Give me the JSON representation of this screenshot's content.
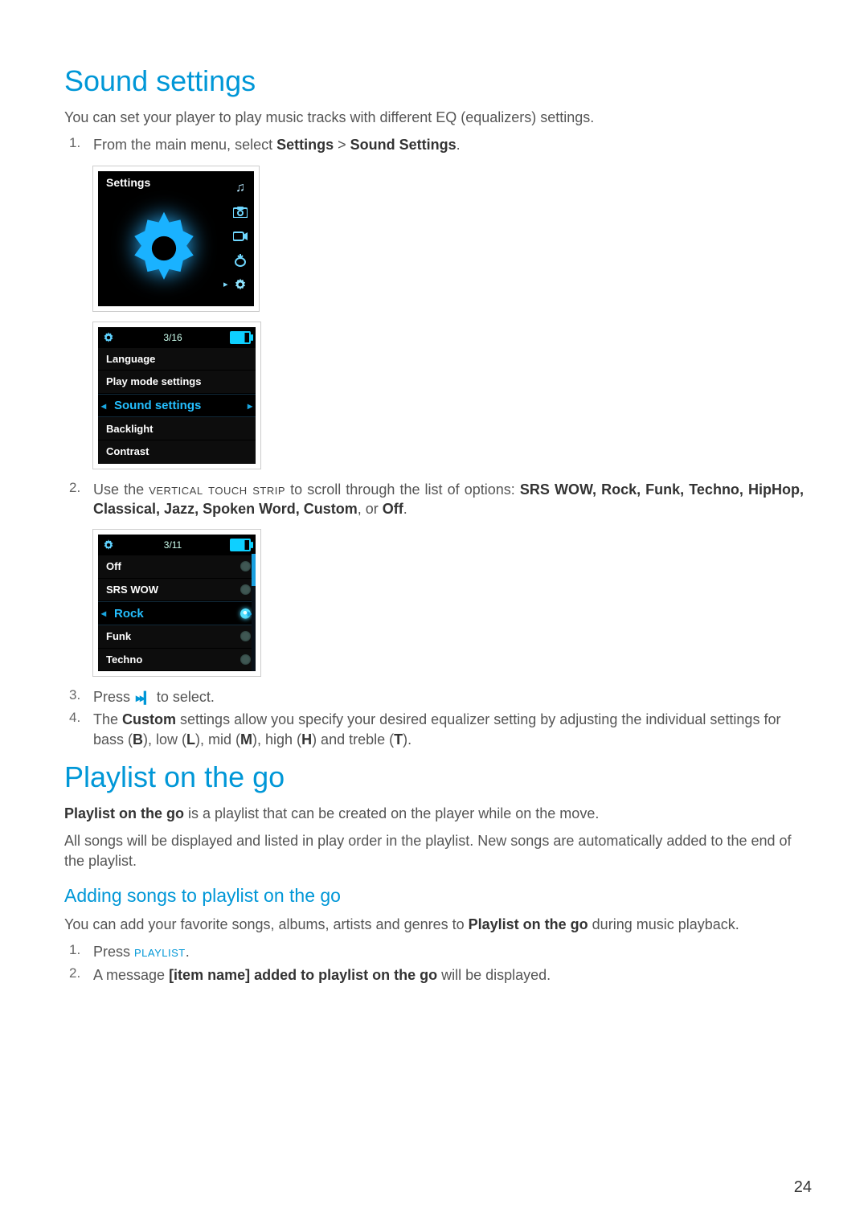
{
  "sections": {
    "sound_settings": {
      "title": "Sound settings",
      "intro": "You can set your player to play music tracks with different EQ (equalizers) settings.",
      "steps": {
        "s1_prefix": "From the main menu, select ",
        "s1_bold1": "Settings",
        "s1_sep": " > ",
        "s1_bold2": "Sound Settings",
        "s1_suffix": ".",
        "s2_prefix": "Use the ",
        "s2_sc": "vertical touch strip",
        "s2_mid": " to scroll through the list of options: ",
        "s2_opts": "SRS WOW, Rock, Funk, Techno, HipHop, Classical, Jazz, Spoken Word, Custom",
        "s2_or": ", or ",
        "s2_off": "Off",
        "s2_suffix": ".",
        "s3_prefix": "Press ",
        "s3_suffix": " to select.",
        "s4_a": "The ",
        "s4_b": "Custom",
        "s4_c": " settings allow you specify your desired equalizer setting by adjusting the individual settings for bass (",
        "s4_B": "B",
        "s4_d": "), low (",
        "s4_L": "L",
        "s4_e": "), mid (",
        "s4_M": "M",
        "s4_f": "), high (",
        "s4_H": "H",
        "s4_g": ") and treble (",
        "s4_T": "T",
        "s4_h": ")."
      },
      "list_nums": {
        "n1": "1.",
        "n2": "2.",
        "n3": "3.",
        "n4": "4."
      }
    },
    "playlist": {
      "title": "Playlist on the go",
      "p1_a": "Playlist on the go",
      "p1_b": " is a playlist that can be created on the player while on the move.",
      "p2": "All songs will be displayed and listed in play order in the playlist. New songs are automatically added to the end of the playlist.",
      "sub_title": "Adding songs to playlist on the go",
      "sub_intro_a": "You can add your favorite songs, albums, artists and genres to ",
      "sub_intro_b": "Playlist on the go",
      "sub_intro_c": " during music playback.",
      "steps": {
        "n1": "1.",
        "n2": "2.",
        "s1_prefix": "Press ",
        "s1_sc": "playlist",
        "s1_suffix": ".",
        "s2_a": "A message ",
        "s2_b": "[item name] added to playlist on the go",
        "s2_c": " will be displayed."
      }
    }
  },
  "screens": {
    "s1": {
      "title": "Settings",
      "thumbs": [
        "music-icon",
        "photo-icon",
        "video-icon",
        "radio-icon",
        "gear-icon"
      ]
    },
    "s2": {
      "counter": "3/16",
      "items": [
        "Language",
        "Play mode settings",
        "Sound settings",
        "Backlight",
        "Contrast"
      ],
      "selected_index": 2
    },
    "s3": {
      "counter": "3/11",
      "items": [
        {
          "label": "Off",
          "sel": false
        },
        {
          "label": "SRS WOW",
          "sel": false
        },
        {
          "label": "Rock",
          "sel": true
        },
        {
          "label": "Funk",
          "sel": false
        },
        {
          "label": "Techno",
          "sel": false
        }
      ]
    }
  },
  "glyphs": {
    "ff": "▸▸▎"
  },
  "page_number": "24"
}
